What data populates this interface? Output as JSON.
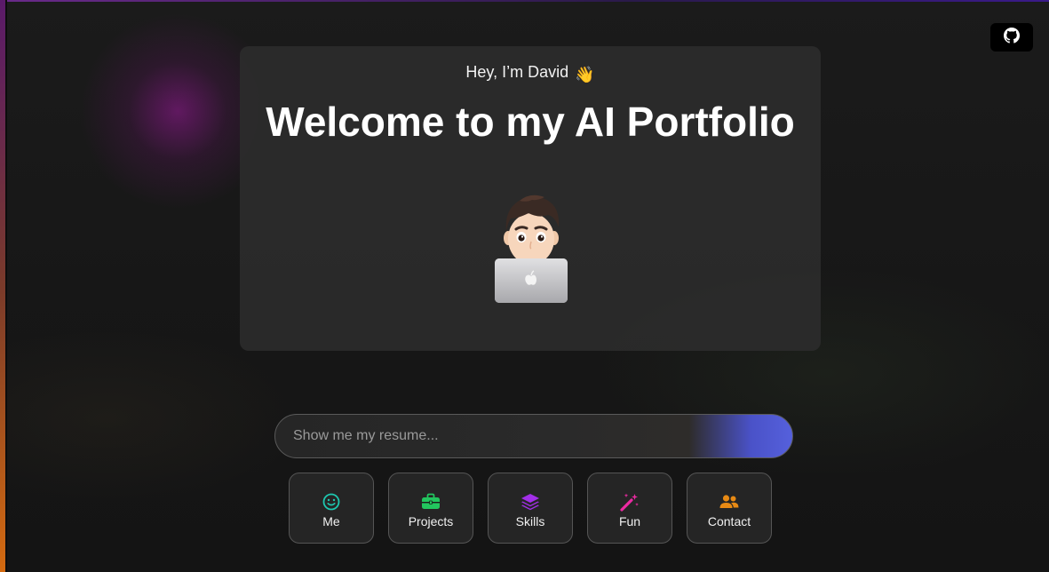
{
  "header": {
    "github_label": "GitHub"
  },
  "hero": {
    "greeting": "Hey, I’m David",
    "greeting_emoji": "👋",
    "title": "Welcome to my AI Portfolio",
    "avatar": "memoji-with-laptop"
  },
  "chat": {
    "placeholder": "Show me my resume...",
    "value": ""
  },
  "nav": {
    "items": [
      {
        "label": "Me",
        "icon": "smile-icon",
        "color": "#1ec7b0"
      },
      {
        "label": "Projects",
        "icon": "briefcase-icon",
        "color": "#22c55e"
      },
      {
        "label": "Skills",
        "icon": "layers-icon",
        "color": "#a22fe8"
      },
      {
        "label": "Fun",
        "icon": "magic-wand-icon",
        "color": "#ec2aa2"
      },
      {
        "label": "Contact",
        "icon": "users-icon",
        "color": "#e88a14"
      }
    ]
  },
  "colors": {
    "card": "#2c2c2c",
    "accent_gradient": "#5560dc",
    "background": "#171717"
  }
}
